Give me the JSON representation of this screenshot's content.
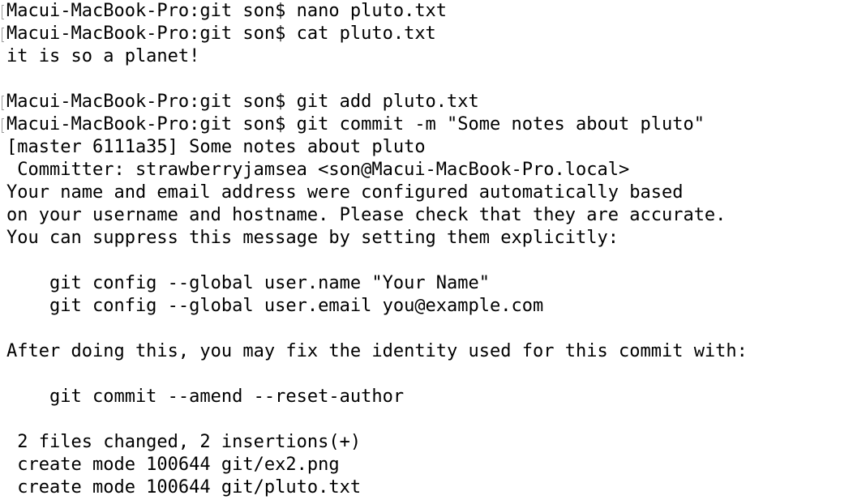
{
  "terminal": {
    "lines": [
      {
        "text": "Macui-MacBook-Pro:git son$ nano pluto.txt",
        "kind": "prompt"
      },
      {
        "text": "Macui-MacBook-Pro:git son$ cat pluto.txt",
        "kind": "prompt"
      },
      {
        "text": "it is so a planet!",
        "kind": "output"
      },
      {
        "text": "",
        "kind": "blank"
      },
      {
        "text": "Macui-MacBook-Pro:git son$ git add pluto.txt",
        "kind": "prompt"
      },
      {
        "text": "Macui-MacBook-Pro:git son$ git commit -m \"Some notes about pluto\"",
        "kind": "prompt"
      },
      {
        "text": "[master 6111a35] Some notes about pluto",
        "kind": "output"
      },
      {
        "text": " Committer: strawberryjamsea <son@Macui-MacBook-Pro.local>",
        "kind": "output"
      },
      {
        "text": "Your name and email address were configured automatically based",
        "kind": "output"
      },
      {
        "text": "on your username and hostname. Please check that they are accurate.",
        "kind": "output"
      },
      {
        "text": "You can suppress this message by setting them explicitly:",
        "kind": "output"
      },
      {
        "text": "",
        "kind": "blank"
      },
      {
        "text": "    git config --global user.name \"Your Name\"",
        "kind": "output"
      },
      {
        "text": "    git config --global user.email you@example.com",
        "kind": "output"
      },
      {
        "text": "",
        "kind": "blank"
      },
      {
        "text": "After doing this, you may fix the identity used for this commit with:",
        "kind": "output"
      },
      {
        "text": "",
        "kind": "blank"
      },
      {
        "text": "    git commit --amend --reset-author",
        "kind": "output"
      },
      {
        "text": "",
        "kind": "blank"
      },
      {
        "text": " 2 files changed, 2 insertions(+)",
        "kind": "output"
      },
      {
        "text": " create mode 100644 git/ex2.png",
        "kind": "output"
      },
      {
        "text": " create mode 100644 git/pluto.txt",
        "kind": "output"
      }
    ]
  }
}
